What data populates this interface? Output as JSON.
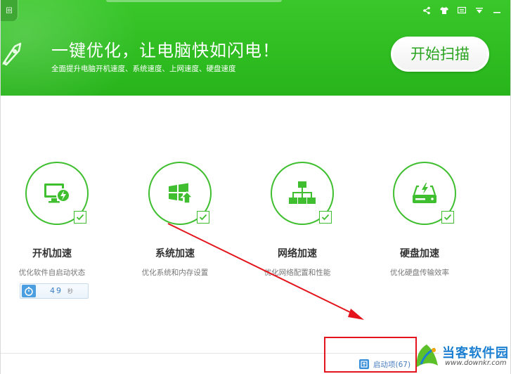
{
  "header": {
    "title": "一键优化，让电脑快如闪电！",
    "subtitle": "全面提升电脑开机速度、系统速度、上网速度、硬盘速度",
    "scan_button": "开始扫描",
    "back_icon": "回",
    "controls": [
      "share-icon",
      "skin-icon",
      "menu-icon",
      "dropdown-icon",
      "minimize-icon"
    ]
  },
  "cards": [
    {
      "title": "开机加速",
      "desc": "优化软件自启动状态",
      "icon": "monitor-lightning-icon"
    },
    {
      "title": "系统加速",
      "desc": "优化系统和内存设置",
      "icon": "windows-up-icon"
    },
    {
      "title": "网络加速",
      "desc": "优化网络配置和性能",
      "icon": "network-tree-icon"
    },
    {
      "title": "硬盘加速",
      "desc": "优化硬盘传输效率",
      "icon": "disk-lightning-icon"
    }
  ],
  "timer": {
    "value": "49",
    "unit": "秒"
  },
  "startup": {
    "label": "启动项(67)"
  },
  "watermark": {
    "name": "当客软件园",
    "url": "www.downkr.com"
  },
  "colors": {
    "brand_green": "#2fbd22",
    "accent_blue": "#4a7fc1",
    "annotation_red": "#e3141b"
  }
}
